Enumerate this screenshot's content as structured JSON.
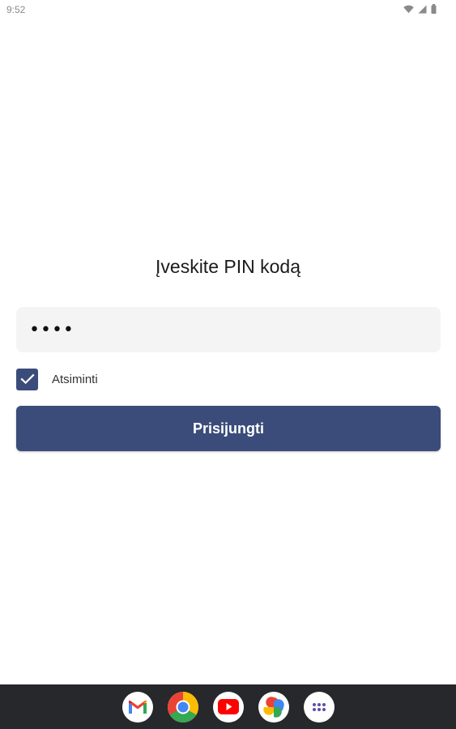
{
  "status_bar": {
    "time": "9:52",
    "icons": [
      "wifi-icon",
      "signal-icon",
      "battery-icon"
    ]
  },
  "login": {
    "title": "Įveskite PIN kodą",
    "pin_value": "••••",
    "remember_label": "Atsiminti",
    "remember_checked": true,
    "submit_label": "Prisijungti"
  },
  "colors": {
    "accent": "#3b4c7a",
    "input_background": "#f4f4f4",
    "dock_background": "#26282b"
  },
  "dock": {
    "apps": [
      "gmail-icon",
      "chrome-icon",
      "youtube-icon",
      "photos-icon",
      "app-drawer-icon"
    ]
  }
}
